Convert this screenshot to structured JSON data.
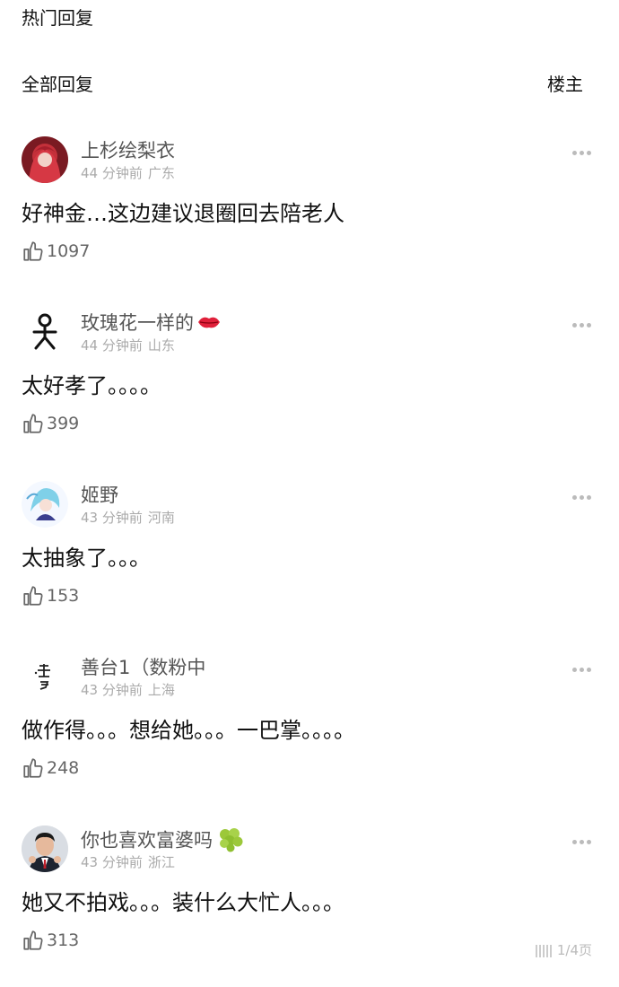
{
  "hot_title": "热门回复",
  "all_title": "全部回复",
  "owner_filter": "楼主",
  "comments": [
    {
      "user": "上杉绘梨衣",
      "time": "44 分钟前",
      "location": "广东",
      "text": "好神金…这边建议退圈回去陪老人",
      "likes": "1097",
      "avatar": "red-hair-avatar-icon"
    },
    {
      "user": "玫瑰花一样的",
      "time": "44 分钟前",
      "location": "山东",
      "text": "太好孝了。。。。",
      "likes": "399",
      "avatar": "stick-figure-avatar-icon",
      "emoji": "lips-emoji-icon"
    },
    {
      "user": "姬野",
      "time": "43 分钟前",
      "location": "河南",
      "text": "太抽象了。。。",
      "likes": "153",
      "avatar": "anime-avatar-icon"
    },
    {
      "user": "善台1（数粉中",
      "time": "43 分钟前",
      "location": "上海",
      "text": "做作得。。。想给她。。。一巴掌。。。。",
      "likes": "248",
      "avatar": "calligraphy-avatar-icon"
    },
    {
      "user": "你也喜欢富婆吗",
      "time": "43 分钟前",
      "location": "浙江",
      "text": "她又不拍戏。。。装什么大忙人。。。",
      "likes": "313",
      "avatar": "man-photo-avatar-icon",
      "emoji": "grapes-emoji-icon"
    }
  ],
  "watermark": "1/4页",
  "colors": {
    "text": "#111111",
    "username": "#555555",
    "meta": "#aaaaaa",
    "like_icon": "#666666"
  }
}
